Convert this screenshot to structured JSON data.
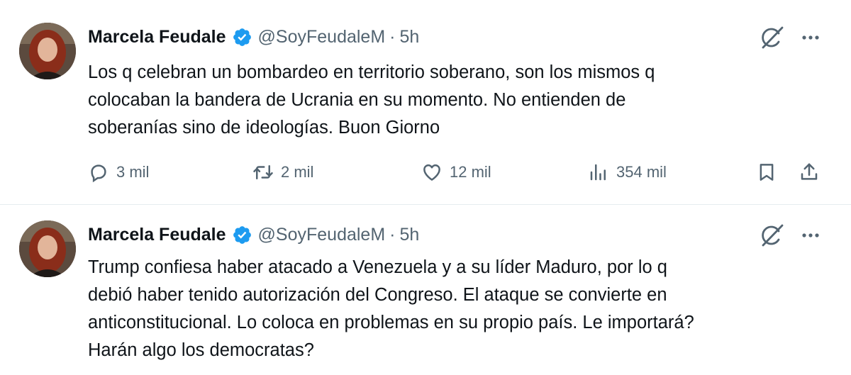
{
  "tweets": [
    {
      "author_name": "Marcela Feudale",
      "handle": "@SoyFeudaleM",
      "separator": "·",
      "time": "5h",
      "text": "Los q celebran un bombardeo en territorio soberano, son los mismos q\ncolocaban la bandera de Ucrania en su momento. No entienden de\nsoberanías sino de ideologías. Buon Giorno",
      "stats": {
        "replies": "3 mil",
        "reposts": "2 mil",
        "likes": "12 mil",
        "views": "354 mil"
      }
    },
    {
      "author_name": "Marcela Feudale",
      "handle": "@SoyFeudaleM",
      "separator": "·",
      "time": "5h",
      "text": "Trump confiesa haber atacado a Venezuela y a su líder Maduro, por lo q\ndebió haber tenido autorización del Congreso. El ataque se convierte en\nanticonstitucional. Lo coloca en problemas en su propio país. Le importará?\nHarán algo los democratas?"
    }
  ],
  "icons": {
    "verified": "verified-badge-icon",
    "grok": "grok-icon",
    "more": "more-icon",
    "reply": "reply-icon",
    "repost": "repost-icon",
    "like": "heart-icon",
    "views": "views-icon",
    "bookmark": "bookmark-icon",
    "share": "share-icon"
  },
  "colors": {
    "verified": "#1d9bf0",
    "text": "#0f1419",
    "secondary": "#536471",
    "divider": "#e6ecf0"
  }
}
